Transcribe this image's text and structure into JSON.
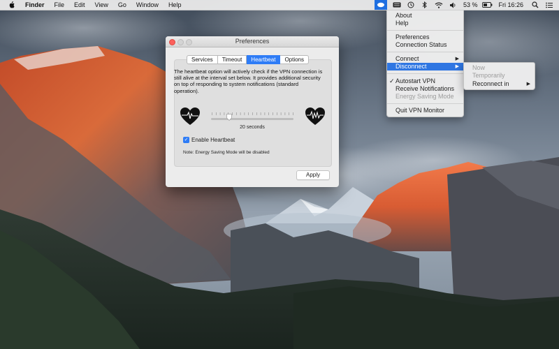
{
  "menubar": {
    "app_name": "Finder",
    "items": [
      "File",
      "Edit",
      "View",
      "Go",
      "Window",
      "Help"
    ],
    "battery": "53 %",
    "clock": "Fri 16:26",
    "status_icons": [
      "vpn-monitor-icon",
      "keyboard-icon",
      "time-machine-icon",
      "bluetooth-icon",
      "wifi-icon",
      "volume-icon",
      "battery-icon",
      "search-icon",
      "notification-center-icon"
    ]
  },
  "menu": {
    "about": "About",
    "help": "Help",
    "preferences": "Preferences",
    "connection_status": "Connection Status",
    "connect": "Connect",
    "disconnect": "Disconnect",
    "autostart": "Autostart VPN",
    "receive_notifications": "Receive Notifications",
    "energy_saving": "Energy Saving Mode",
    "quit": "Quit VPN Monitor",
    "arrow": "▶",
    "check": "✓"
  },
  "submenu": {
    "now": "Now",
    "temporarily": "Temporarily",
    "reconnect_in": "Reconnect in"
  },
  "window": {
    "title": "Preferences",
    "tabs": [
      "Services",
      "Timeout",
      "Heartbeat",
      "Options"
    ],
    "selected_tab": "Heartbeat",
    "description": "The heartbeat option will actively check if the VPN connection is still alive at the interval set below. It provides additional security on top of responding to system notifications (standard operation).",
    "slider_value_label": "20 seconds",
    "slider_fraction": 0.2,
    "checkbox_label": "Enable Heartbeat",
    "checkbox_checked": true,
    "note": "Note: Energy Saving Mode will be disabled",
    "apply_label": "Apply"
  },
  "colors": {
    "accent": "#2e7cf6",
    "menu_highlight": "#2f76e2",
    "close_button": "#fc605c"
  }
}
